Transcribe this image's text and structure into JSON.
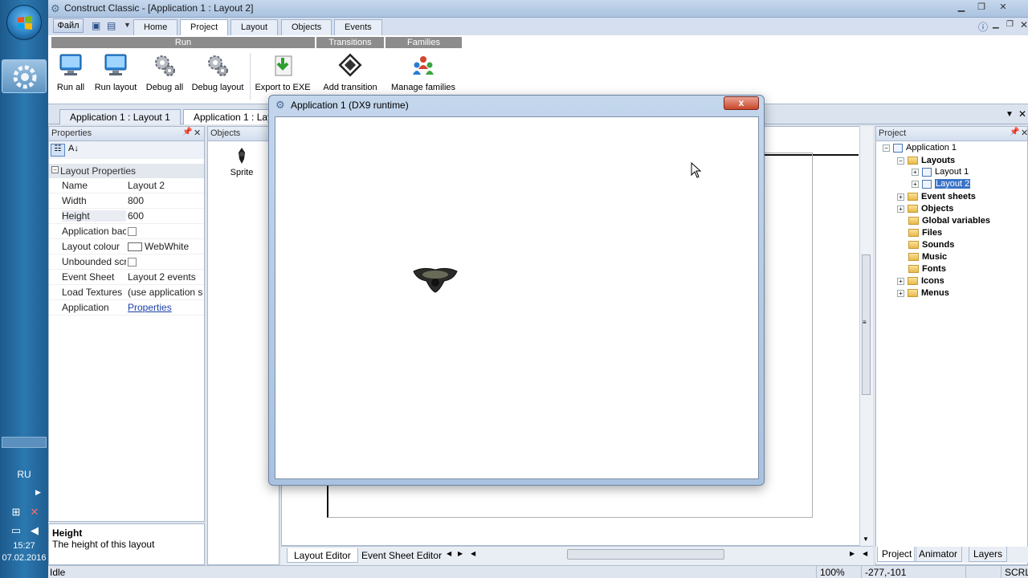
{
  "taskbar": {
    "lang": "RU",
    "time": "15:27",
    "date": "07.02.2016"
  },
  "window": {
    "title": "Construct Classic - [Application 1 : Layout 2]"
  },
  "ribbon": {
    "file_menu": "Файл",
    "tabs": [
      "Home",
      "Project",
      "Layout",
      "Objects",
      "Events"
    ],
    "active_tab": "Project",
    "groups": {
      "run": "Run",
      "transitions": "Transitions",
      "families": "Families"
    },
    "buttons": {
      "run_all": "Run all",
      "run_layout": "Run layout",
      "debug_all": "Debug all",
      "debug_layout": "Debug layout",
      "export_exe": "Export to EXE",
      "add_transition": "Add transition",
      "manage_families": "Manage families"
    }
  },
  "doc_tabs": [
    "Application 1 : Layout 1",
    "Application 1 : Lay"
  ],
  "properties": {
    "header": "Properties",
    "group": "Layout Properties",
    "rows": [
      {
        "key": "Name",
        "value": "Layout 2"
      },
      {
        "key": "Width",
        "value": "800"
      },
      {
        "key": "Height",
        "value": "600"
      },
      {
        "key": "Application bac",
        "value": ""
      },
      {
        "key": "Layout colour",
        "value": "WebWhite"
      },
      {
        "key": "Unbounded scr",
        "value": ""
      },
      {
        "key": "Event Sheet",
        "value": "Layout 2 events"
      },
      {
        "key": "Load Textures",
        "value": "(use application se"
      },
      {
        "key": "Application",
        "value": "Properties"
      }
    ],
    "desc_title": "Height",
    "desc_text": "The height of this layout"
  },
  "objects": {
    "header": "Objects",
    "item": "Sprite"
  },
  "editor": {
    "tabs": [
      "Layout Editor",
      "Event Sheet Editor"
    ]
  },
  "project": {
    "header": "Project",
    "root": "Application 1",
    "layouts": "Layouts",
    "layout1": "Layout 1",
    "layout2": "Layout 2",
    "folders": [
      "Event sheets",
      "Objects",
      "Global variables",
      "Files",
      "Sounds",
      "Music",
      "Fonts",
      "Icons",
      "Menus"
    ],
    "tabs": [
      "Project",
      "Animator",
      "Layers"
    ]
  },
  "status": {
    "text": "Idle",
    "zoom": "100%",
    "coords": "-277,-101",
    "scrl": "SCRL"
  },
  "dialog": {
    "title": "Application 1 (DX9 runtime)",
    "close": "x"
  },
  "colors": {
    "group_header": "#8c8c8c",
    "selection": "#3a73c8",
    "link": "#1b3ea8"
  }
}
